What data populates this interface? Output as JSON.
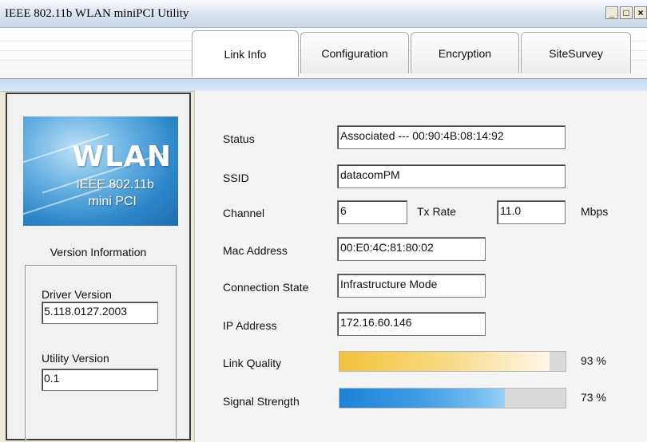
{
  "window": {
    "title": "IEEE 802.11b WLAN miniPCI Utility"
  },
  "window_buttons": {
    "minimize": "_",
    "maximize": "□",
    "close": "×"
  },
  "tabs": [
    {
      "label": "Link Info",
      "active": true
    },
    {
      "label": "Configuration",
      "active": false
    },
    {
      "label": "Encryption",
      "active": false
    },
    {
      "label": "SiteSurvey",
      "active": false
    }
  ],
  "logo": {
    "line1": "WLAN",
    "line2": "IEEE 802.11b",
    "line3": "mini PCI"
  },
  "version": {
    "heading": "Version Information",
    "driver_label": "Driver Version",
    "driver_value": "5.118.0127.2003",
    "utility_label": "Utility Version",
    "utility_value": "0.1"
  },
  "link": {
    "status_label": "Status",
    "status_value": "Associated --- 00:90:4B:08:14:92",
    "ssid_label": "SSID",
    "ssid_value": "datacomPM",
    "channel_label": "Channel",
    "channel_value": "6",
    "txrate_label": "Tx Rate",
    "txrate_value": "11.0",
    "txrate_unit": "Mbps",
    "mac_label": "Mac Address",
    "mac_value": "00:E0:4C:81:80:02",
    "state_label": "Connection State",
    "state_value": "Infrastructure Mode",
    "ip_label": "IP Address",
    "ip_value": "172.16.60.146",
    "quality_label": "Link Quality",
    "quality_percent": 93,
    "quality_text": "93 %",
    "signal_label": "Signal Strength",
    "signal_percent": 73,
    "signal_text": "73 %"
  },
  "colors": {
    "quality_bar": "#f2c23c",
    "signal_bar": "#1e82d8",
    "logo_blue": "#2d86c8"
  }
}
